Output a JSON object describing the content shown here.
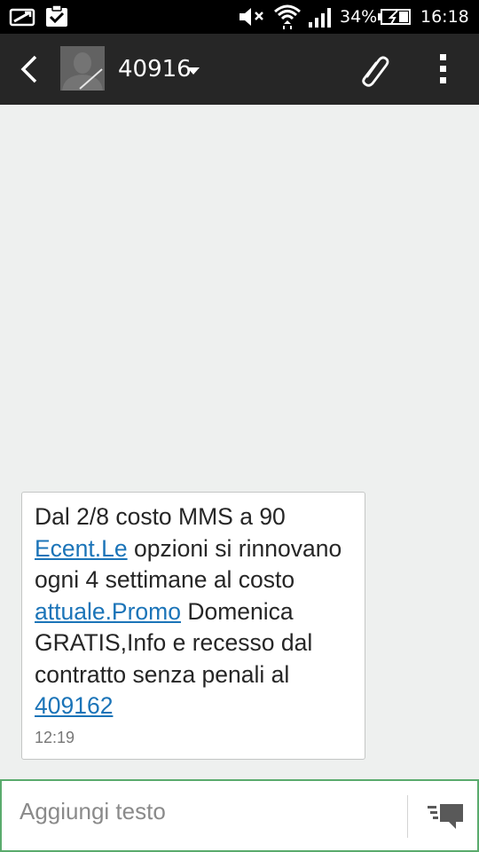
{
  "status_bar": {
    "battery": "34%",
    "time": "16:18"
  },
  "header": {
    "contact": "40916",
    "icons": [
      "back-icon",
      "avatar",
      "dropdown-caret-icon",
      "paperclip-icon",
      "more-vert-icon"
    ]
  },
  "message": {
    "segments": [
      {
        "text": "Dal 2/8 costo MMS a 90 ",
        "link": false
      },
      {
        "text": "Ecent.Le",
        "link": true
      },
      {
        "text": " opzioni si rinnovano ogni 4 settimane al costo ",
        "link": false
      },
      {
        "text": "attuale.Promo",
        "link": true
      },
      {
        "text": " Domenica GRATIS,Info e recesso dal contratto senza penali al ",
        "link": false
      },
      {
        "text": "409162",
        "link": true
      }
    ],
    "time": "12:19"
  },
  "composer": {
    "placeholder": "Aggiungi testo",
    "value": ""
  },
  "colors": {
    "status_bar": "#000000",
    "action_bar": "#262626",
    "background": "#eef0ef",
    "link": "#1b74b8",
    "composer_border": "#5aab6d"
  }
}
